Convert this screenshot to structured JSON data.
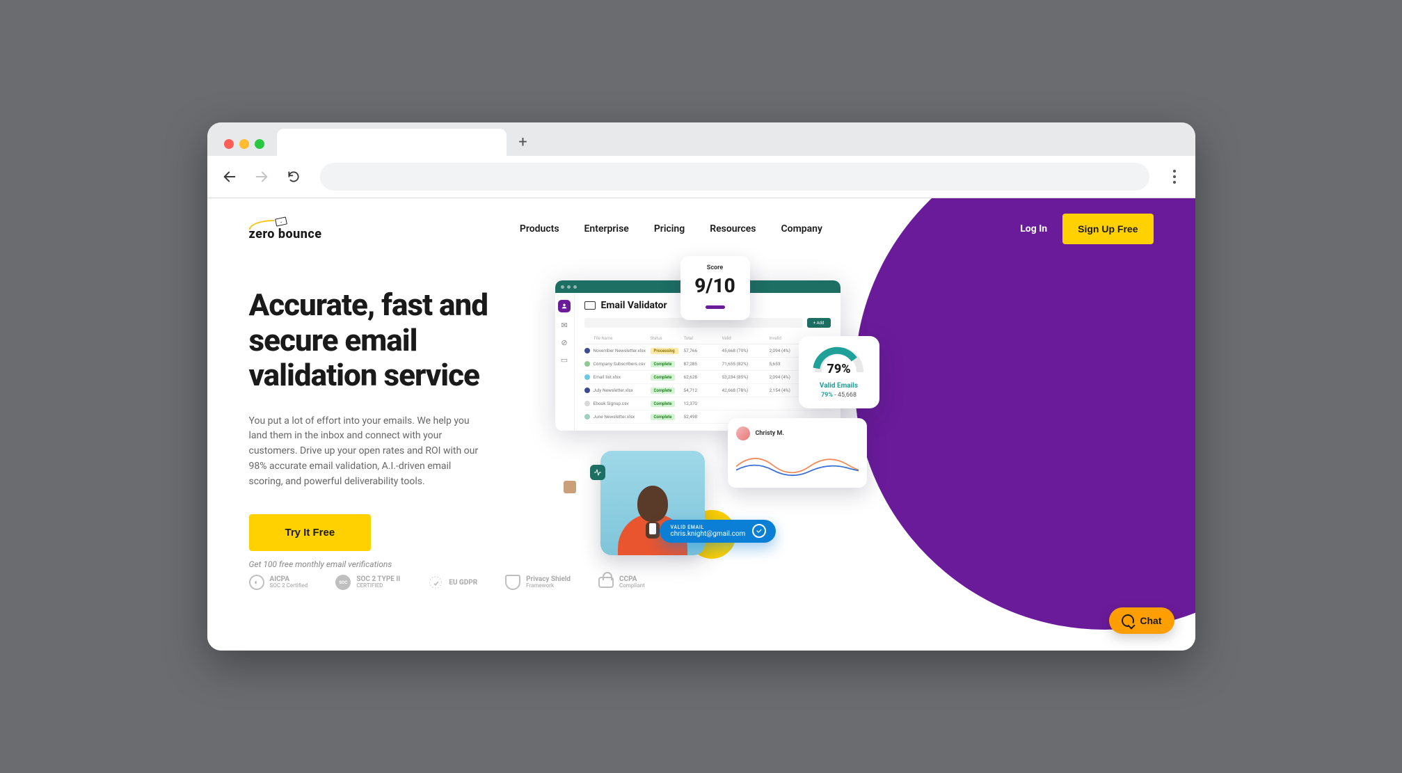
{
  "brand": {
    "name_part1": "zero",
    "name_part2": "bounce"
  },
  "nav": {
    "products": "Products",
    "enterprise": "Enterprise",
    "pricing": "Pricing",
    "resources": "Resources",
    "company": "Company"
  },
  "auth": {
    "login": "Log In",
    "signup": "Sign Up Free"
  },
  "hero": {
    "title": "Accurate, fast and secure email validation service",
    "desc": "You put a lot of effort into your emails. We help you land them in the inbox and connect with your customers. Drive up your open rates and ROI with our 98% accurate email validation, A.I.-driven email scoring, and powerful deliverability tools.",
    "cta": "Try It Free",
    "cta_sub": "Get 100 free monthly email verifications"
  },
  "dashboard": {
    "title": "Email Validator",
    "add_btn": "+ Add",
    "columns": {
      "file": "File Name",
      "status": "Status",
      "total": "Total",
      "valid": "Valid",
      "invalid": "Invalid"
    },
    "rows": [
      {
        "color": "#3d4b8f",
        "file": "November Newsletter.xlsx",
        "status": "Processing",
        "status_type": "processing",
        "total": "57,766",
        "valid": "45,668 (79%)",
        "invalid": "2,094 (4%)"
      },
      {
        "color": "#8fc98f",
        "file": "Company Subscribers.csv",
        "status": "Complete",
        "status_type": "complete",
        "total": "87,285",
        "valid": "71,655 (82%)",
        "invalid": "5,653"
      },
      {
        "color": "#6fc7e8",
        "file": "Email list.xlsx",
        "status": "Complete",
        "status_type": "complete",
        "total": "62,628",
        "valid": "53,234 (85%)",
        "invalid": "2,094 (4%)"
      },
      {
        "color": "#3d4b8f",
        "file": "July Newsletter.xlsx",
        "status": "Complete",
        "status_type": "complete",
        "total": "54,712",
        "valid": "42,668 (78%)",
        "invalid": "2,154 (4%)"
      },
      {
        "color": "#d8d8d8",
        "file": "Ebook Signup.csv",
        "status": "Complete",
        "status_type": "complete",
        "total": "12,370",
        "valid": "",
        "invalid": ""
      },
      {
        "color": "#9fcfc0",
        "file": "June Newsletter.xlsx",
        "status": "Complete",
        "status_type": "complete",
        "total": "52,498",
        "valid": "",
        "invalid": ""
      }
    ]
  },
  "score": {
    "label": "Score",
    "value": "9/10"
  },
  "gauge": {
    "percent": "79%",
    "label": "Valid Emails",
    "pct_small": "79%",
    "count": " - 45,668"
  },
  "person": {
    "name": "Christy M."
  },
  "pill": {
    "tag": "VALID EMAIL",
    "email": "chris.knight@gmail.com"
  },
  "badges": {
    "aicpa": {
      "line1": "AICPA",
      "line2": "SOC 2 Certified"
    },
    "soc2": {
      "line1": "SOC 2 TYPE II",
      "line2": "CERTIFIED"
    },
    "gdpr": {
      "text": "EU GDPR"
    },
    "privacy": {
      "line1": "Privacy Shield",
      "line2": "Framework"
    },
    "ccpa": {
      "line1": "CCPA",
      "line2": "Compliant"
    }
  },
  "chat": {
    "label": "Chat"
  }
}
